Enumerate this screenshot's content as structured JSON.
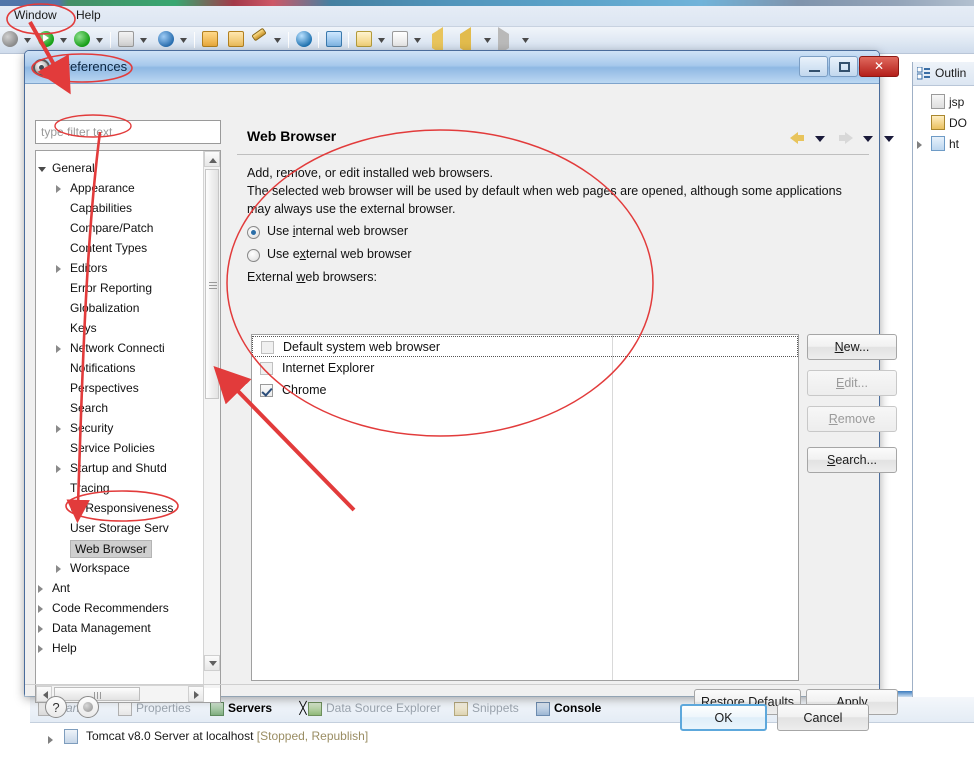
{
  "ide": {
    "menu": {
      "window": "Window",
      "help": "Help"
    },
    "outline": {
      "tab_label": "Outlin",
      "rows": [
        {
          "label": "jsp",
          "icon": "code-tag-icon"
        },
        {
          "label": "DO",
          "icon": "doctype-icon"
        },
        {
          "label": "ht",
          "icon": "html-element-icon"
        }
      ]
    },
    "bottom_tabs": [
      {
        "label": "Markers",
        "icon": "markers-icon",
        "state": "dim-italic"
      },
      {
        "label": "Properties",
        "icon": "properties-icon",
        "state": "dim"
      },
      {
        "label": "Servers",
        "icon": "servers-icon",
        "state": "active"
      },
      {
        "label": "Data Source Explorer",
        "icon": "datasource-icon",
        "state": "dim"
      },
      {
        "label": "Snippets",
        "icon": "snippets-icon",
        "state": "dim"
      },
      {
        "label": "Console",
        "icon": "console-icon",
        "state": "bold"
      }
    ],
    "servers_view": {
      "server_name": "Tomcat v8.0 Server at localhost",
      "server_state": "[Stopped, Republish]"
    }
  },
  "dialog": {
    "title": "Preferences",
    "window_buttons": {
      "minimize": "minimize",
      "maximize": "maximize",
      "close": "✕"
    },
    "filter": {
      "placeholder": "type filter text",
      "value": ""
    },
    "tree": [
      {
        "label": "General",
        "level": 0,
        "twisty": "open",
        "selected": false
      },
      {
        "label": "Appearance",
        "level": 1,
        "twisty": "closed",
        "selected": false
      },
      {
        "label": "Capabilities",
        "level": 1,
        "twisty": "none",
        "selected": false
      },
      {
        "label": "Compare/Patch",
        "level": 1,
        "twisty": "none",
        "selected": false
      },
      {
        "label": "Content Types",
        "level": 1,
        "twisty": "none",
        "selected": false
      },
      {
        "label": "Editors",
        "level": 1,
        "twisty": "closed",
        "selected": false
      },
      {
        "label": "Error Reporting",
        "level": 1,
        "twisty": "none",
        "selected": false
      },
      {
        "label": "Globalization",
        "level": 1,
        "twisty": "none",
        "selected": false
      },
      {
        "label": "Keys",
        "level": 1,
        "twisty": "none",
        "selected": false
      },
      {
        "label": "Network Connecti",
        "level": 1,
        "twisty": "closed",
        "selected": false
      },
      {
        "label": "Notifications",
        "level": 1,
        "twisty": "none",
        "selected": false
      },
      {
        "label": "Perspectives",
        "level": 1,
        "twisty": "none",
        "selected": false
      },
      {
        "label": "Search",
        "level": 1,
        "twisty": "none",
        "selected": false
      },
      {
        "label": "Security",
        "level": 1,
        "twisty": "closed",
        "selected": false
      },
      {
        "label": "Service Policies",
        "level": 1,
        "twisty": "none",
        "selected": false
      },
      {
        "label": "Startup and Shutd",
        "level": 1,
        "twisty": "closed",
        "selected": false
      },
      {
        "label": "Tracing",
        "level": 1,
        "twisty": "none",
        "selected": false
      },
      {
        "label": "UI Responsiveness",
        "level": 1,
        "twisty": "none",
        "selected": false
      },
      {
        "label": "User Storage Serv",
        "level": 1,
        "twisty": "none",
        "selected": false
      },
      {
        "label": "Web Browser",
        "level": 1,
        "twisty": "none",
        "selected": true
      },
      {
        "label": "Workspace",
        "level": 1,
        "twisty": "closed",
        "selected": false
      },
      {
        "label": "Ant",
        "level": 0,
        "twisty": "closed",
        "selected": false
      },
      {
        "label": "Code Recommenders",
        "level": 0,
        "twisty": "closed",
        "selected": false
      },
      {
        "label": "Data Management",
        "level": 0,
        "twisty": "closed",
        "selected": false
      },
      {
        "label": "Help",
        "level": 0,
        "twisty": "closed",
        "selected": false
      }
    ],
    "page": {
      "title": "Web Browser",
      "description_lines": [
        "Add, remove, or edit installed web browsers.",
        "The selected web browser will be used by default when web pages are opened, although some applications",
        "may always use the external browser."
      ],
      "radios": [
        {
          "label": "Use internal web browser",
          "checked": true,
          "mnemonic": "i"
        },
        {
          "label": "Use external web browser",
          "checked": false,
          "mnemonic": "x"
        }
      ],
      "list_label": "External web browsers:",
      "browsers": [
        {
          "label": "Default system web browser",
          "checked": false,
          "focused": true
        },
        {
          "label": "Internet Explorer",
          "checked": false,
          "focused": false
        },
        {
          "label": "Chrome",
          "checked": true,
          "focused": false
        }
      ],
      "side_buttons": [
        {
          "label": "New...",
          "enabled": true,
          "mnemonic": "N"
        },
        {
          "label": "Edit...",
          "enabled": false,
          "mnemonic": "E"
        },
        {
          "label": "Remove",
          "enabled": false,
          "mnemonic": "R"
        },
        {
          "label": "Search...",
          "enabled": true,
          "mnemonic": "S"
        }
      ],
      "nav": {
        "back": "back-arrow",
        "forward": "forward-arrow",
        "menu": "view-menu"
      }
    },
    "footer_buttons": {
      "restore_defaults": "Restore Defaults",
      "apply": "Apply",
      "ok": "OK",
      "cancel": "Cancel"
    },
    "footer_icons": {
      "help": "?",
      "shell": "shell-dot"
    }
  },
  "annotations": {
    "color": "#e23b3b",
    "marks": [
      {
        "kind": "ellipse",
        "target": "window-menu"
      },
      {
        "kind": "ellipse",
        "target": "preferences-title"
      },
      {
        "kind": "ellipse",
        "target": "general-tree-item"
      },
      {
        "kind": "ellipse",
        "target": "web-browser-tree-item"
      },
      {
        "kind": "ellipse",
        "target": "browser-settings-region"
      },
      {
        "kind": "arrow",
        "target": "from-window-menu-to-preferences"
      },
      {
        "kind": "arrow",
        "target": "from-general-to-web-browser"
      },
      {
        "kind": "arrow",
        "target": "from-web-browser-to-list"
      }
    ]
  }
}
